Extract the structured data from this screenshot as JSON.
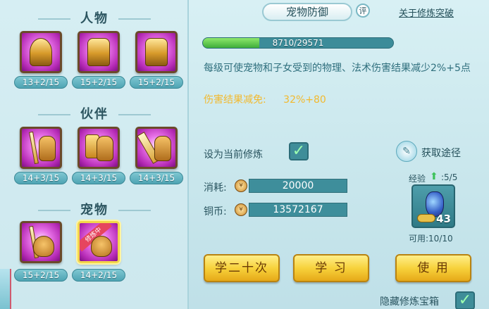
{
  "left": {
    "sections": [
      {
        "title": "人物",
        "slots": [
          {
            "icon": "golden-buddha-figure-icon",
            "level": "13+2/15",
            "selected": false
          },
          {
            "icon": "golden-shield-warrior-icon",
            "level": "15+2/15",
            "selected": false
          },
          {
            "icon": "golden-armored-figure-icon",
            "level": "15+2/15",
            "selected": false
          }
        ]
      },
      {
        "title": "伙伴",
        "slots": [
          {
            "icon": "sword-beast-icon",
            "level": "14+3/15",
            "selected": false
          },
          {
            "icon": "shield-beast-icon",
            "level": "14+3/15",
            "selected": false
          },
          {
            "icon": "claw-beast-icon",
            "level": "14+3/15",
            "selected": false
          }
        ]
      },
      {
        "title": "宠物",
        "slots": [
          {
            "icon": "sword-cat-icon",
            "level": "15+2/15",
            "selected": false
          },
          {
            "icon": "training-cat-icon",
            "level": "14+2/15",
            "selected": true,
            "ribbon": "修炼中"
          }
        ]
      }
    ]
  },
  "right": {
    "title": "宠物防御",
    "ping_badge": "评",
    "breakthrough_link": "关于修炼突破",
    "exp": {
      "current": 8710,
      "max": 29571,
      "text": "8710/29571"
    },
    "description": "每级可使宠物和子女受到的物理、法术伤害结果减少2%+5点",
    "effect_label": "伤害结果减免:",
    "effect_value": "32%+80",
    "set_current_label": "设为当前修炼",
    "set_current_checked": true,
    "acquire_label": "获取途径",
    "cost_label": "消耗:",
    "cost_value": "20000",
    "copper_label": "铜币:",
    "copper_value": "13572167",
    "treasure": {
      "exp_label": "经验",
      "exp_count": ":5/5",
      "count": "43",
      "usable": "可用:10/10"
    },
    "buttons": {
      "learn20": "学二十次",
      "learn": "学 习",
      "use": "使 用"
    },
    "hide_label": "隐藏修炼宝箱",
    "hide_checked": true
  },
  "colors": {
    "gold_text": "#f2b92e",
    "teal_text": "#2f6f7d",
    "exp_fill": "#3fae3a"
  }
}
